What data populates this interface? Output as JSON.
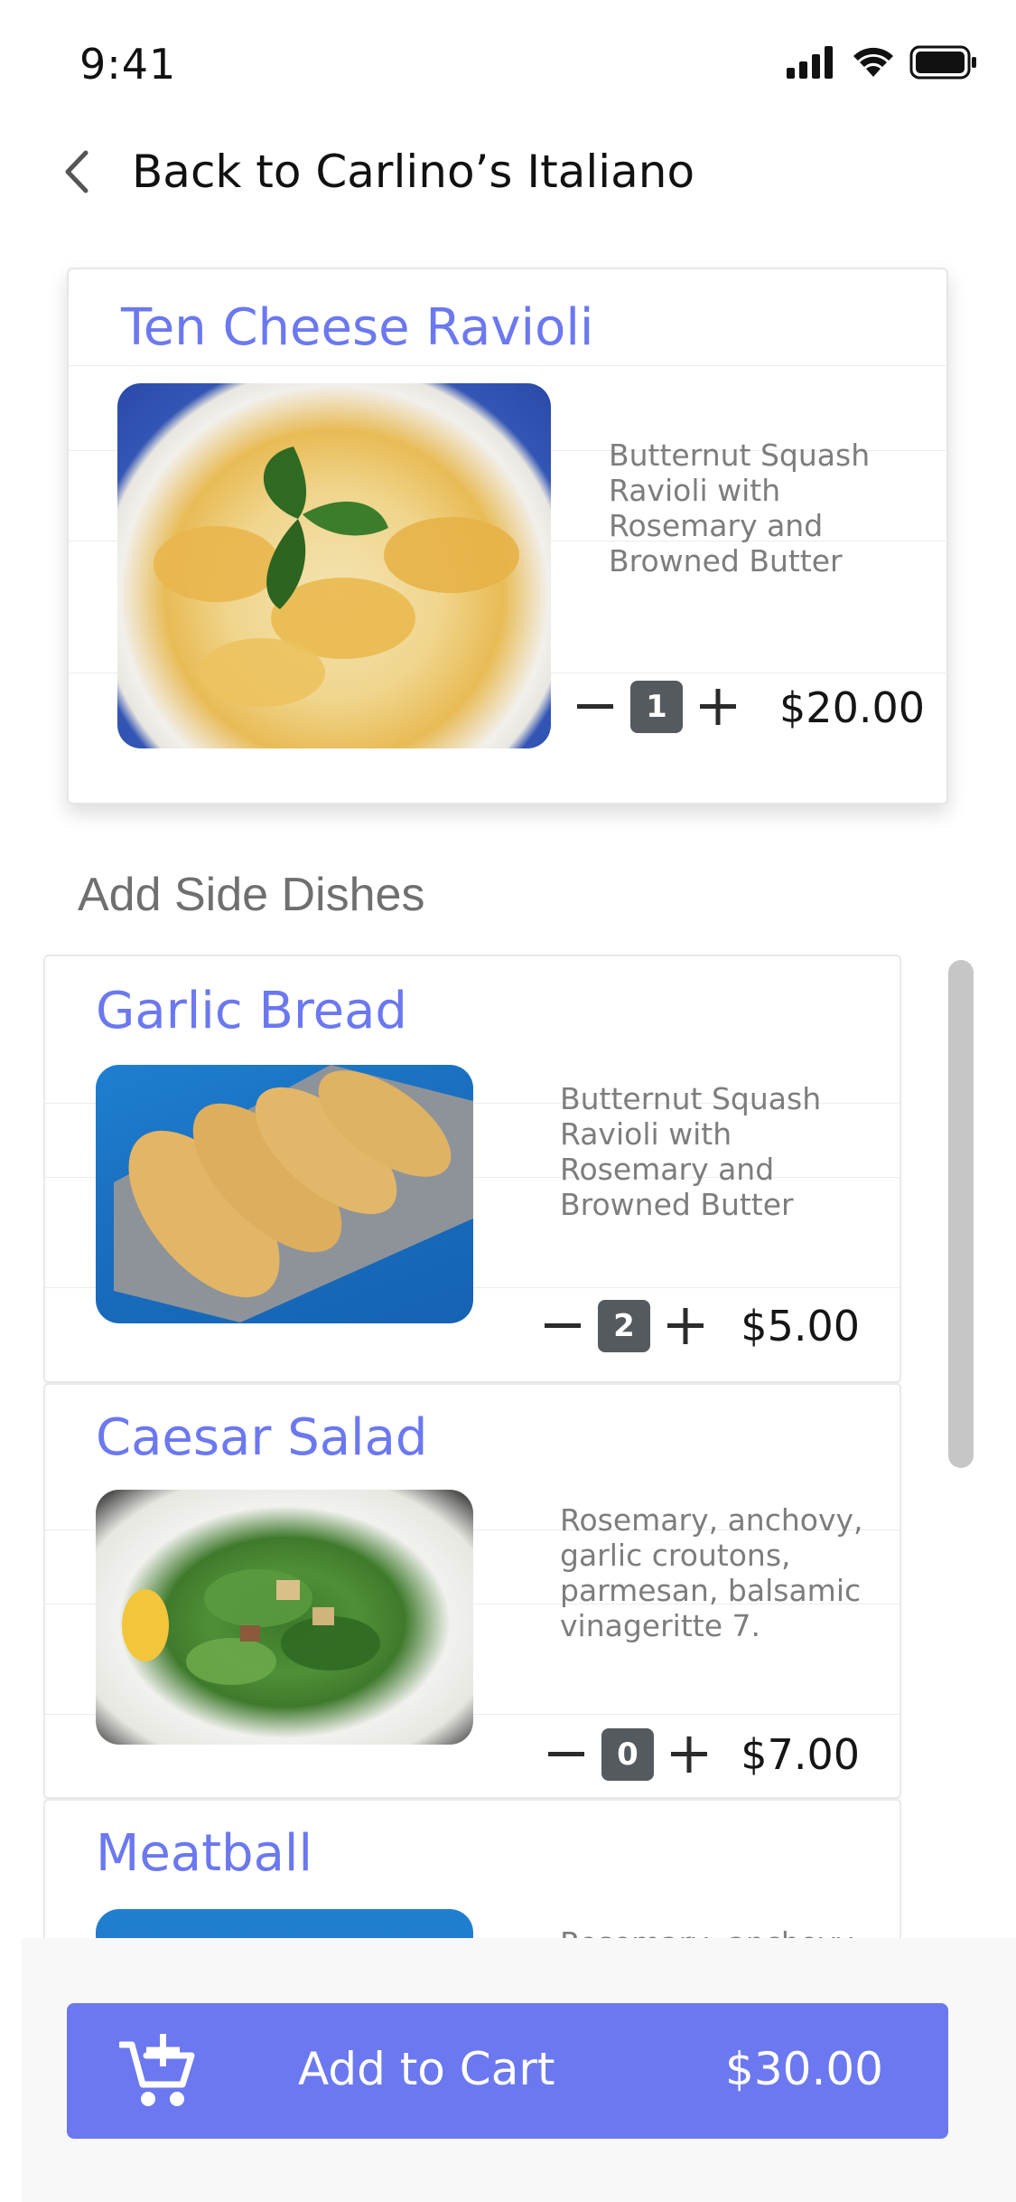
{
  "status_bar": {
    "time": "9:41",
    "icons": [
      "signal-icon",
      "wifi-icon",
      "battery-icon"
    ]
  },
  "nav": {
    "back_label": "Back to Carlino’s Italiano"
  },
  "main_item": {
    "title": "Ten Cheese Ravioli",
    "description": "Butternut Squash Ravioli with Rosemary and Browned Butter",
    "quantity": "1",
    "price": "$20.00"
  },
  "side_section": {
    "title": "Add Side Dishes"
  },
  "side_dishes": [
    {
      "title": "Garlic Bread",
      "description": "Butternut Squash Ravioli with Rosemary and Browned Butter",
      "quantity": "2",
      "price": "$5.00"
    },
    {
      "title": "Caesar Salad",
      "description": "Rosemary, anchovy, garlic croutons, parmesan, balsamic vinageritte 7.",
      "quantity": "0",
      "price": "$7.00"
    },
    {
      "title": "Meatball",
      "description": "Rosemary, anchovy"
    }
  ],
  "cart": {
    "label": "Add to Cart",
    "total": "$30.00"
  },
  "colors": {
    "accent": "#6b78f0",
    "qty_badge": "#555a5e",
    "scrollbar": "#c6c6c6"
  }
}
